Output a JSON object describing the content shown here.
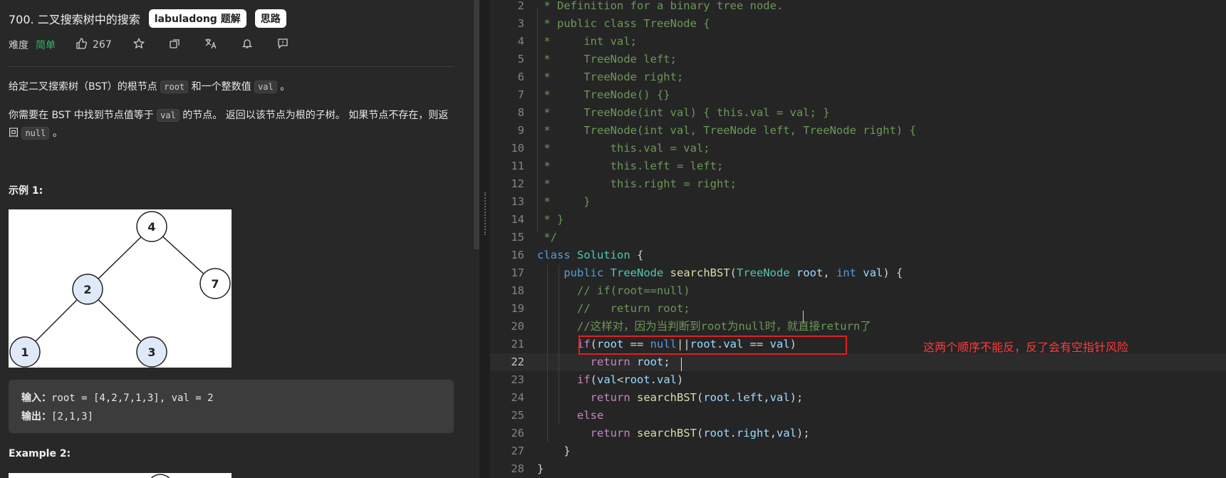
{
  "problem": {
    "title": "700. 二叉搜索树中的搜索",
    "tags": [
      "labuladong 题解",
      "思路"
    ],
    "difficulty_label": "难度",
    "difficulty": "简单",
    "likes": "267",
    "desc1_a": "给定二叉搜索树（BST）的根节点",
    "desc1_code1": "root",
    "desc1_b": "和一个整数值",
    "desc1_code2": "val",
    "desc1_c": "。",
    "desc2_a": "你需要在 BST 中找到节点值等于",
    "desc2_code1": "val",
    "desc2_b": "的节点。 返回以该节点为根的子树。 如果节点不存在，则返回",
    "desc2_code2": "null",
    "desc2_c": "。",
    "example1_heading": "示例 1:",
    "example1_input_label": "输入：",
    "example1_input": "root = [4,2,7,1,3], val = 2",
    "example1_output_label": "输出：",
    "example1_output": "[2,1,3]",
    "example2_heading": "Example 2:",
    "tree_nodes": [
      "4",
      "2",
      "7",
      "1",
      "3"
    ]
  },
  "editor": {
    "current_line": 22,
    "lines": [
      {
        "n": "2",
        "text": " * Definition for a binary tree node.",
        "cls": "comment"
      },
      {
        "n": "3",
        "text": " * public class TreeNode {",
        "cls": "comment"
      },
      {
        "n": "4",
        "text": " *     int val;",
        "cls": "comment"
      },
      {
        "n": "5",
        "text": " *     TreeNode left;",
        "cls": "comment"
      },
      {
        "n": "6",
        "text": " *     TreeNode right;",
        "cls": "comment"
      },
      {
        "n": "7",
        "text": " *     TreeNode() {}",
        "cls": "comment"
      },
      {
        "n": "8",
        "text": " *     TreeNode(int val) { this.val = val; }",
        "cls": "comment"
      },
      {
        "n": "9",
        "text": " *     TreeNode(int val, TreeNode left, TreeNode right) {",
        "cls": "comment"
      },
      {
        "n": "10",
        "text": " *         this.val = val;",
        "cls": "comment"
      },
      {
        "n": "11",
        "text": " *         this.left = left;",
        "cls": "comment"
      },
      {
        "n": "12",
        "text": " *         this.right = right;",
        "cls": "comment"
      },
      {
        "n": "13",
        "text": " *     }",
        "cls": "comment"
      },
      {
        "n": "14",
        "text": " * }",
        "cls": "comment"
      },
      {
        "n": "15",
        "text": " */",
        "cls": "comment"
      },
      {
        "n": "16",
        "text": "class Solution {",
        "cls": "code"
      },
      {
        "n": "17",
        "text": "    public TreeNode searchBST(TreeNode root, int val) {",
        "cls": "code"
      },
      {
        "n": "18",
        "text": "      // if(root==null)",
        "cls": "comment"
      },
      {
        "n": "19",
        "text": "      //   return root;",
        "cls": "comment"
      },
      {
        "n": "20",
        "text": "      //这样对，因为当判断到root为null时，就直接return了",
        "cls": "comment"
      },
      {
        "n": "21",
        "text": "      if(root == null||root.val == val)",
        "cls": "code"
      },
      {
        "n": "22",
        "text": "        return root;",
        "cls": "code"
      },
      {
        "n": "23",
        "text": "      if(val<root.val)",
        "cls": "code"
      },
      {
        "n": "24",
        "text": "        return searchBST(root.left,val);",
        "cls": "code"
      },
      {
        "n": "25",
        "text": "      else",
        "cls": "code"
      },
      {
        "n": "26",
        "text": "        return searchBST(root.right,val);",
        "cls": "code"
      },
      {
        "n": "27",
        "text": "    }",
        "cls": "code"
      },
      {
        "n": "28",
        "text": "}",
        "cls": "code"
      }
    ],
    "annotation": "这两个顺序不能反，反了会有空指针风险"
  },
  "colors": {
    "keyword": "#569cd6",
    "type": "#4ec9b0",
    "method": "#dcdcaa",
    "param": "#9cdcfe",
    "comment": "#6a9955",
    "control": "#c586c0",
    "annotation": "#ff3b3b",
    "easy": "#2cbb5d"
  }
}
